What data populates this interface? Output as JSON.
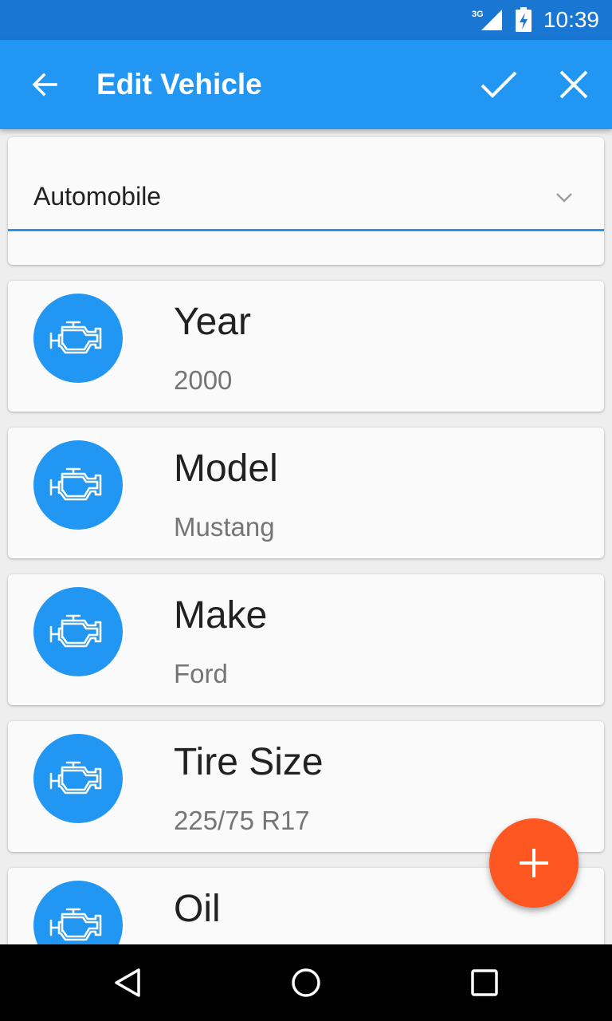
{
  "status_bar": {
    "network": "3G",
    "time": "10:39"
  },
  "app_bar": {
    "title": "Edit Vehicle",
    "back_icon": "arrow-back-icon",
    "confirm_icon": "check-icon",
    "cancel_icon": "close-icon"
  },
  "vehicle_type": {
    "selected": "Automobile",
    "icon": "chevron-down-icon"
  },
  "fields": [
    {
      "label": "Year",
      "value": "2000",
      "icon": "engine-icon"
    },
    {
      "label": "Model",
      "value": "Mustang",
      "icon": "engine-icon"
    },
    {
      "label": "Make",
      "value": "Ford",
      "icon": "engine-icon"
    },
    {
      "label": "Tire Size",
      "value": "225/75 R17",
      "icon": "engine-icon"
    },
    {
      "label": "Oil",
      "value": "",
      "icon": "engine-icon"
    }
  ],
  "fab": {
    "icon": "add-icon"
  },
  "nav_bar": {
    "back_icon": "nav-back-icon",
    "home_icon": "nav-home-icon",
    "recents_icon": "nav-recents-icon"
  },
  "colors": {
    "status_bar": "#1976d2",
    "primary": "#2196f3",
    "accent": "#ff5722",
    "background": "#eeeeee",
    "card": "#fafafa"
  }
}
